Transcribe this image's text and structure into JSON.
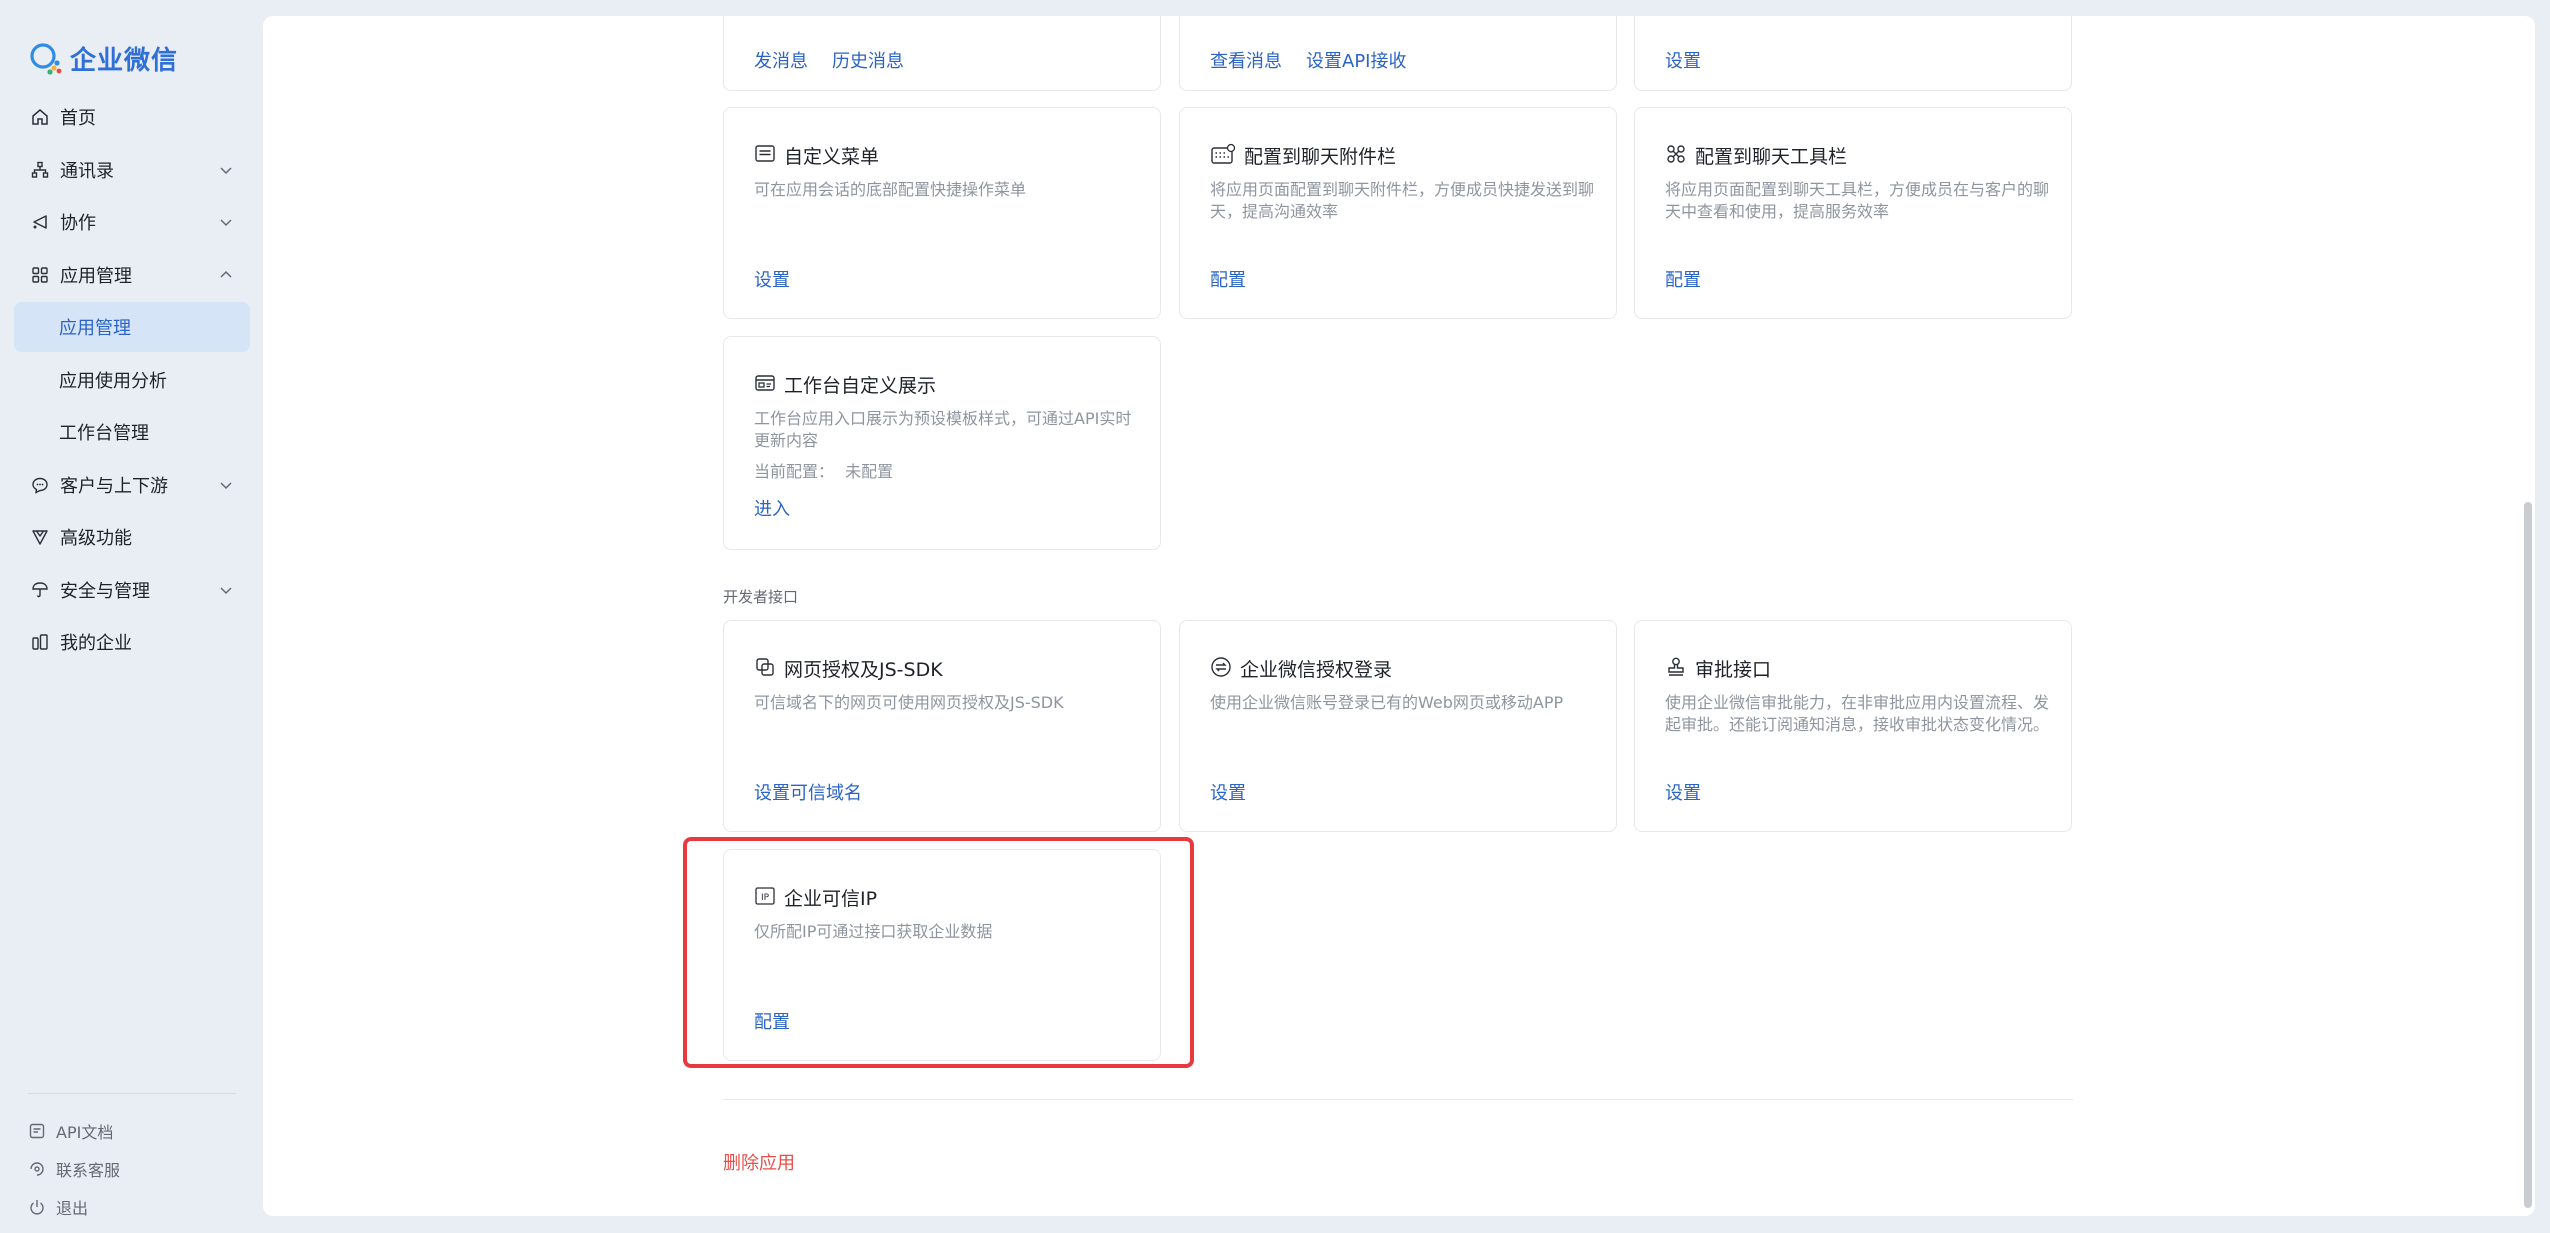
{
  "brand": {
    "name": "企业微信",
    "color": "#2f6fd6"
  },
  "sidebar": {
    "items": [
      {
        "label": "首页",
        "icon": "home-icon"
      },
      {
        "label": "通讯录",
        "icon": "contacts-icon",
        "expandable": true
      },
      {
        "label": "协作",
        "icon": "collab-icon",
        "expandable": true
      },
      {
        "label": "应用管理",
        "icon": "apps-icon",
        "expandable": true,
        "expanded": true
      },
      {
        "label": "应用管理",
        "sub": true,
        "active": true
      },
      {
        "label": "应用使用分析",
        "sub": true
      },
      {
        "label": "工作台管理",
        "sub": true
      },
      {
        "label": "客户与上下游",
        "icon": "customer-icon",
        "expandable": true
      },
      {
        "label": "高级功能",
        "icon": "advanced-icon"
      },
      {
        "label": "安全与管理",
        "icon": "security-icon",
        "expandable": true
      },
      {
        "label": "我的企业",
        "icon": "company-icon"
      }
    ],
    "bottom": [
      {
        "label": "API文档",
        "icon": "doc-icon"
      },
      {
        "label": "联系客服",
        "icon": "support-icon"
      },
      {
        "label": "退出",
        "icon": "power-icon"
      }
    ]
  },
  "cards": {
    "top1": {
      "links": [
        "发消息",
        "历史消息"
      ]
    },
    "top2": {
      "links": [
        "查看消息",
        "设置API接收"
      ]
    },
    "top3": {
      "links": [
        "设置"
      ]
    },
    "menu": {
      "title": "自定义菜单",
      "desc": "可在应用会话的底部配置快捷操作菜单",
      "link": "设置"
    },
    "attach": {
      "title": "配置到聊天附件栏",
      "desc": "将应用页面配置到聊天附件栏，方便成员快捷发送到聊天，提高沟通效率",
      "link": "配置"
    },
    "toolbar": {
      "title": "配置到聊天工具栏",
      "desc": "将应用页面配置到聊天工具栏，方便成员在与客户的聊天中查看和使用，提高服务效率",
      "link": "配置"
    },
    "workbench": {
      "title": "工作台自定义展示",
      "desc": "工作台应用入口展示为预设模板样式，可通过API实时更新内容",
      "status_label": "当前配置：",
      "status_value": "未配置",
      "link": "进入"
    },
    "jssdk": {
      "title": "网页授权及JS-SDK",
      "desc": "可信域名下的网页可使用网页授权及JS-SDK",
      "link": "设置可信域名"
    },
    "login": {
      "title": "企业微信授权登录",
      "desc": "使用企业微信账号登录已有的Web网页或移动APP",
      "link": "设置"
    },
    "approval": {
      "title": "审批接口",
      "desc": "使用企业微信审批能力，在非审批应用内设置流程、发起审批。还能订阅通知消息，接收审批状态变化情况。",
      "link": "设置"
    },
    "trusted_ip": {
      "title": "企业可信IP",
      "desc": "仅所配IP可通过接口获取企业数据",
      "link": "配置"
    }
  },
  "section_dev": "开发者接口",
  "delete_app": "删除应用",
  "colors": {
    "link": "#2c64c6",
    "danger": "#e5504a",
    "highlight": "#e8393e"
  }
}
